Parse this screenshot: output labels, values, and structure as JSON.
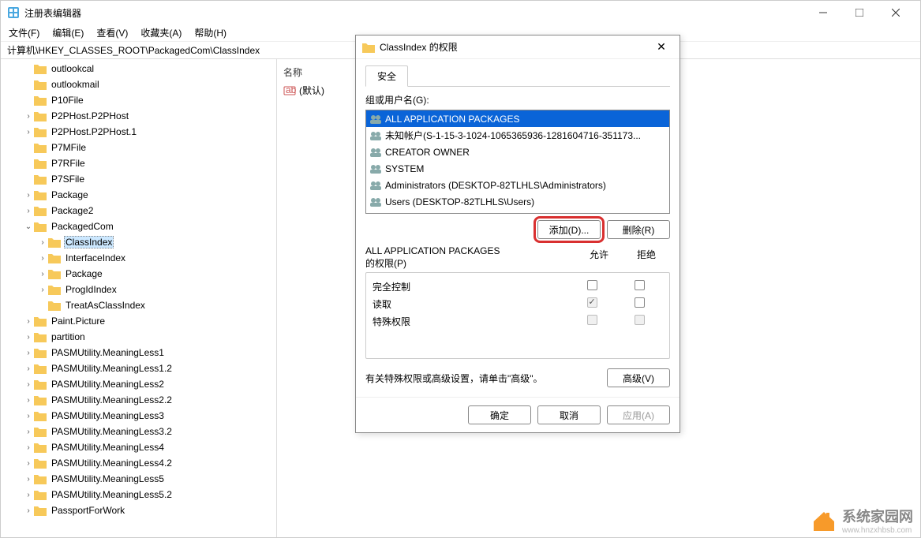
{
  "window": {
    "title": "注册表编辑器",
    "address": "计算机\\HKEY_CLASSES_ROOT\\PackagedCom\\ClassIndex"
  },
  "menu": {
    "file": "文件(F)",
    "edit": "编辑(E)",
    "view": "查看(V)",
    "favorites": "收藏夹(A)",
    "help": "帮助(H)"
  },
  "list": {
    "header_name": "名称",
    "default_row": "(默认)"
  },
  "tree": {
    "items": [
      {
        "indent": 1,
        "toggle": "",
        "label": "outlookcal"
      },
      {
        "indent": 1,
        "toggle": "",
        "label": "outlookmail"
      },
      {
        "indent": 1,
        "toggle": "",
        "label": "P10File"
      },
      {
        "indent": 1,
        "toggle": ">",
        "label": "P2PHost.P2PHost"
      },
      {
        "indent": 1,
        "toggle": ">",
        "label": "P2PHost.P2PHost.1"
      },
      {
        "indent": 1,
        "toggle": "",
        "label": "P7MFile"
      },
      {
        "indent": 1,
        "toggle": "",
        "label": "P7RFile"
      },
      {
        "indent": 1,
        "toggle": "",
        "label": "P7SFile"
      },
      {
        "indent": 1,
        "toggle": ">",
        "label": "Package"
      },
      {
        "indent": 1,
        "toggle": ">",
        "label": "Package2"
      },
      {
        "indent": 1,
        "toggle": "v",
        "label": "PackagedCom"
      },
      {
        "indent": 2,
        "toggle": ">",
        "label": "ClassIndex",
        "selected": true
      },
      {
        "indent": 2,
        "toggle": ">",
        "label": "InterfaceIndex"
      },
      {
        "indent": 2,
        "toggle": ">",
        "label": "Package"
      },
      {
        "indent": 2,
        "toggle": ">",
        "label": "ProgIdIndex"
      },
      {
        "indent": 2,
        "toggle": "",
        "label": "TreatAsClassIndex"
      },
      {
        "indent": 1,
        "toggle": ">",
        "label": "Paint.Picture"
      },
      {
        "indent": 1,
        "toggle": ">",
        "label": "partition"
      },
      {
        "indent": 1,
        "toggle": ">",
        "label": "PASMUtility.MeaningLess1"
      },
      {
        "indent": 1,
        "toggle": ">",
        "label": "PASMUtility.MeaningLess1.2"
      },
      {
        "indent": 1,
        "toggle": ">",
        "label": "PASMUtility.MeaningLess2"
      },
      {
        "indent": 1,
        "toggle": ">",
        "label": "PASMUtility.MeaningLess2.2"
      },
      {
        "indent": 1,
        "toggle": ">",
        "label": "PASMUtility.MeaningLess3"
      },
      {
        "indent": 1,
        "toggle": ">",
        "label": "PASMUtility.MeaningLess3.2"
      },
      {
        "indent": 1,
        "toggle": ">",
        "label": "PASMUtility.MeaningLess4"
      },
      {
        "indent": 1,
        "toggle": ">",
        "label": "PASMUtility.MeaningLess4.2"
      },
      {
        "indent": 1,
        "toggle": ">",
        "label": "PASMUtility.MeaningLess5"
      },
      {
        "indent": 1,
        "toggle": ">",
        "label": "PASMUtility.MeaningLess5.2"
      },
      {
        "indent": 1,
        "toggle": ">",
        "label": "PassportForWork"
      }
    ]
  },
  "dialog": {
    "title": "ClassIndex 的权限",
    "tab_security": "安全",
    "group_label": "组或用户名(G):",
    "principals": [
      {
        "name": "ALL APPLICATION PACKAGES",
        "selected": true,
        "icon": "group"
      },
      {
        "name": "未知帐户(S-1-15-3-1024-1065365936-1281604716-351173...",
        "icon": "group"
      },
      {
        "name": "CREATOR OWNER",
        "icon": "group"
      },
      {
        "name": "SYSTEM",
        "icon": "group"
      },
      {
        "name": "Administrators (DESKTOP-82TLHLS\\Administrators)",
        "icon": "group"
      },
      {
        "name": "Users (DESKTOP-82TLHLS\\Users)",
        "icon": "group"
      }
    ],
    "add_btn": "添加(D)...",
    "remove_btn": "删除(R)",
    "perm_for_label_1": "ALL APPLICATION PACKAGES",
    "perm_for_label_2": "的权限(P)",
    "col_allow": "允许",
    "col_deny": "拒绝",
    "perms": [
      {
        "name": "完全控制",
        "allow": false,
        "deny": false,
        "allow_disabled": false,
        "deny_disabled": false
      },
      {
        "name": "读取",
        "allow": true,
        "deny": false,
        "allow_disabled": true,
        "deny_disabled": false
      },
      {
        "name": "特殊权限",
        "allow": false,
        "deny": false,
        "allow_disabled": true,
        "deny_disabled": true
      }
    ],
    "advanced_text": "有关特殊权限或高级设置，请单击\"高级\"。",
    "advanced_btn": "高级(V)",
    "ok_btn": "确定",
    "cancel_btn": "取消",
    "apply_btn": "应用(A)"
  },
  "watermark": {
    "text": "系统家园网",
    "sub": "www.hnzxhbsb.com"
  }
}
